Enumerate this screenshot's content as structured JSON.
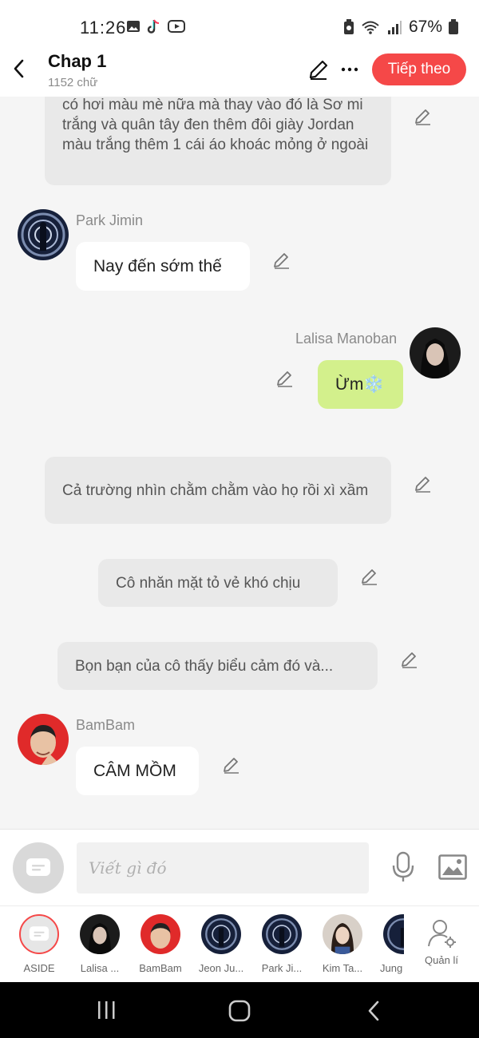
{
  "status_bar": {
    "time": "11:26",
    "battery": "67%",
    "icons": [
      "gallery-icon",
      "tiktok-icon",
      "youtube-icon",
      "battery-saver-icon",
      "wifi-icon",
      "signal-icon",
      "battery-icon"
    ]
  },
  "header": {
    "title": "Chap 1",
    "subtitle": "1152 chữ",
    "next_label": "Tiếp theo"
  },
  "chat": {
    "messages": [
      {
        "type": "narration",
        "text": "có hơi màu mè nữa mà thay vào đó là Sơ mi trắng và quân tây đen thêm đôi giày Jordan màu trắng thêm 1 cái áo khoác mỏng ở ngoài"
      },
      {
        "type": "left",
        "name": "Park Jimin",
        "text": "Nay đến sớm thế"
      },
      {
        "type": "right",
        "name": "Lalisa Manoban",
        "text": "Ừm❄️"
      },
      {
        "type": "narration",
        "text": "Cả trường nhìn chằm chằm vào họ rồi xì xầm"
      },
      {
        "type": "narration",
        "text": "Cô nhăn mặt tỏ vẻ khó chịu"
      },
      {
        "type": "narration",
        "text": "Bọn bạn của cô thấy biểu cảm đó và..."
      },
      {
        "type": "left",
        "name": "BamBam",
        "text": "CÂM MỒM"
      }
    ]
  },
  "input": {
    "placeholder": "Viết gì đó"
  },
  "characters": [
    {
      "label": "ASIDE"
    },
    {
      "label": "Lalisa ..."
    },
    {
      "label": "BamBam"
    },
    {
      "label": "Jeon Ju..."
    },
    {
      "label": "Park Ji..."
    },
    {
      "label": "Kim Ta..."
    },
    {
      "label": "Jung"
    },
    {
      "label": "Quản lí"
    }
  ],
  "colors": {
    "accent": "#f54848",
    "self_bubble": "#d3f08c",
    "narration_bubble": "#e9e9e9"
  }
}
